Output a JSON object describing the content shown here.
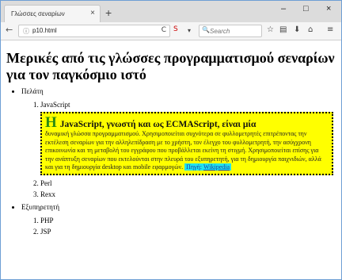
{
  "browser": {
    "tab_title": "Γλώσσες σεναρίων",
    "tab_close": "×",
    "new_tab": "+",
    "window_controls": [
      "–",
      "□",
      "×"
    ],
    "url": "p10.html",
    "search_placeholder": "Search",
    "nav": {
      "back": "←",
      "info": "ⓘ",
      "reload": "C",
      "noscript": "S",
      "dropdown": "▾"
    },
    "toolbar_icons": {
      "star": "☆",
      "library": "▤",
      "download": "⬇",
      "home": "⌂",
      "menu": "≡"
    }
  },
  "page": {
    "heading": "Μερικές από τις γλώσσες προγραμματισμού σεναρίων για τον παγκόσμιο ιστό",
    "groups": [
      {
        "label": "Πελάτη",
        "languages": [
          "JavaScript",
          "Perl",
          "Rexx"
        ]
      },
      {
        "label": "Εξυπηρετητή",
        "languages": [
          "PHP",
          "JSP"
        ]
      }
    ],
    "highlight": {
      "dropcap": "H",
      "title": "JavaScript, γνωστή και ως ECMAScript, είναι μία",
      "body": "δυναμική γλώσσα προγραμματισμού. Χρησιμοποιείται συχνότερα σε φυλλομετρητές επιτρέποντας την εκτέλεση σεναρίων για την αλληλεπίδραση με το χρήστη, τον έλεγχο του φυλλομετρητή, την ασύγχρονη επικοινωνία και τη μεταβολή του εγγράφου που προβάλλεται εκείνη τη στιγμή. Χρησιμοποιείται επίσης για την ανάπτυξη σεναρίων που εκτελούνται στην πλευρά του εξυπηρετητή, για τη δημιουργία παιχνιδιών, αλλά και για τη δημιουργία desktop και mobile εφαρμογών.",
      "source_label": "Πηγή",
      "source_link": "Wikipedia"
    }
  }
}
